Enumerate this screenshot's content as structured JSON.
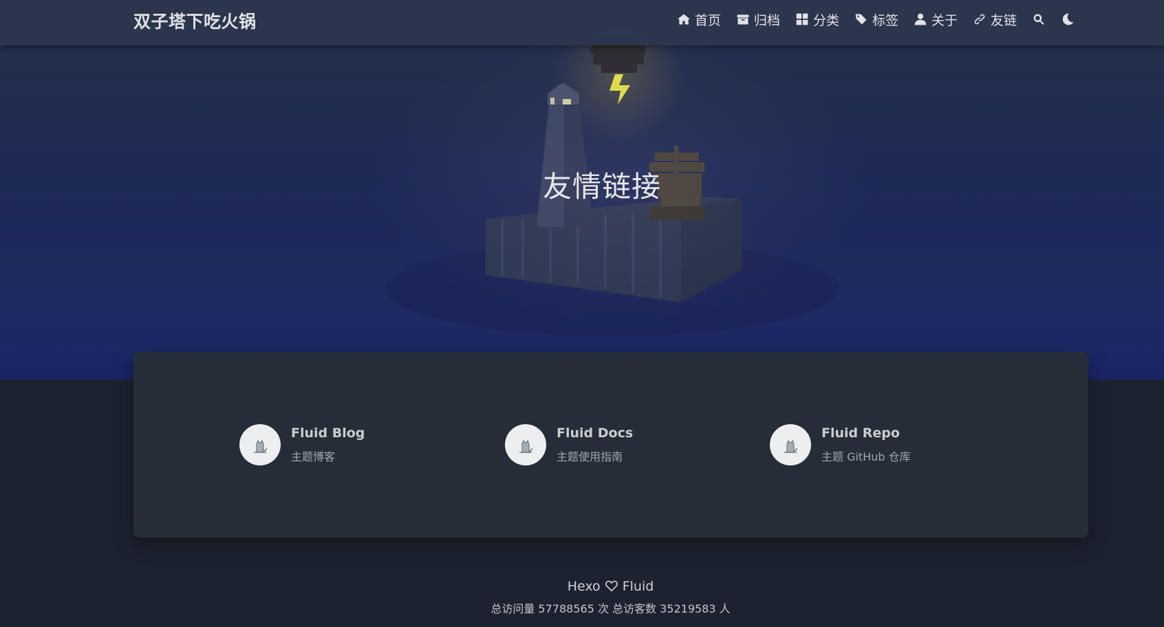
{
  "navbar": {
    "brand": "双子塔下吃火锅",
    "items": [
      {
        "label": "首页",
        "icon": "home-icon"
      },
      {
        "label": "归档",
        "icon": "archive-icon"
      },
      {
        "label": "分类",
        "icon": "category-icon"
      },
      {
        "label": "标签",
        "icon": "tag-icon"
      },
      {
        "label": "关于",
        "icon": "user-icon"
      },
      {
        "label": "友链",
        "icon": "link-icon"
      }
    ],
    "search_icon": "search-icon",
    "theme_icon": "moon-icon"
  },
  "hero": {
    "title": "友情链接"
  },
  "links": [
    {
      "title": "Fluid Blog",
      "desc": "主题博客",
      "avatar": "cat-avatar"
    },
    {
      "title": "Fluid Docs",
      "desc": "主题使用指南",
      "avatar": "cat-avatar"
    },
    {
      "title": "Fluid Repo",
      "desc": "主题 GitHub 仓库",
      "avatar": "cat-avatar"
    }
  ],
  "footer": {
    "left": "Hexo",
    "right": "Fluid",
    "stats": "总访问量 57788565 次  总访客数 35219583 人"
  },
  "colors": {
    "navbar": "#2c364c",
    "board": "#252d38",
    "page": "#1c2230",
    "lightning": "#e8e24a"
  }
}
